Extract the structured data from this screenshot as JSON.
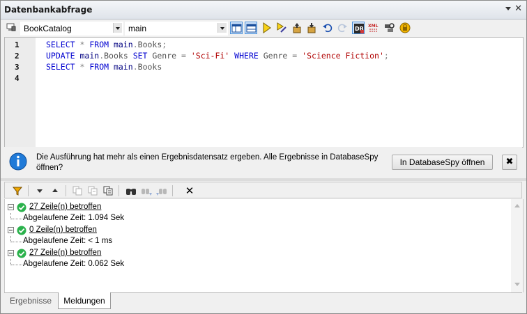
{
  "window": {
    "title": "Datenbankabfrage"
  },
  "toolbar": {
    "connection": "BookCatalog",
    "schema": "main",
    "icons": [
      "connection-icon",
      "layout-editor-icon",
      "layout-results-icon",
      "execute-icon",
      "execute-for-edit-icon",
      "import-file-icon",
      "export-file-icon",
      "undo-icon",
      "redo-icon",
      "open-in-databasespy-icon",
      "xml-schema-icon",
      "options-icon",
      "autocommit-icon"
    ]
  },
  "editor": {
    "line_numbers": [
      "1",
      "2",
      "3",
      "4"
    ],
    "lines": [
      [
        {
          "t": "SELECT",
          "c": "kw"
        },
        {
          "t": " ",
          "c": ""
        },
        {
          "t": "*",
          "c": "op"
        },
        {
          "t": " ",
          "c": ""
        },
        {
          "t": "FROM",
          "c": "kw"
        },
        {
          "t": " ",
          "c": ""
        },
        {
          "t": "main",
          "c": "id"
        },
        {
          "t": ".",
          "c": "op"
        },
        {
          "t": "Books",
          "c": "gy"
        },
        {
          "t": ";",
          "c": "op"
        }
      ],
      [
        {
          "t": "UPDATE",
          "c": "kw"
        },
        {
          "t": " ",
          "c": ""
        },
        {
          "t": "main",
          "c": "id"
        },
        {
          "t": ".",
          "c": "op"
        },
        {
          "t": "Books",
          "c": "gy"
        },
        {
          "t": " ",
          "c": ""
        },
        {
          "t": "SET",
          "c": "kw"
        },
        {
          "t": " ",
          "c": ""
        },
        {
          "t": "Genre",
          "c": "gy"
        },
        {
          "t": " ",
          "c": ""
        },
        {
          "t": "=",
          "c": "op"
        },
        {
          "t": " ",
          "c": ""
        },
        {
          "t": "'Sci-Fi'",
          "c": "str"
        },
        {
          "t": " ",
          "c": ""
        },
        {
          "t": "WHERE",
          "c": "kw"
        },
        {
          "t": " ",
          "c": ""
        },
        {
          "t": "Genre",
          "c": "gy"
        },
        {
          "t": " ",
          "c": ""
        },
        {
          "t": "=",
          "c": "op"
        },
        {
          "t": " ",
          "c": ""
        },
        {
          "t": "'Science Fiction'",
          "c": "str"
        },
        {
          "t": ";",
          "c": "op"
        }
      ],
      [
        {
          "t": "SELECT",
          "c": "kw"
        },
        {
          "t": " ",
          "c": ""
        },
        {
          "t": "*",
          "c": "op"
        },
        {
          "t": " ",
          "c": ""
        },
        {
          "t": "FROM",
          "c": "kw"
        },
        {
          "t": " ",
          "c": ""
        },
        {
          "t": "main",
          "c": "id"
        },
        {
          "t": ".",
          "c": "op"
        },
        {
          "t": "Books",
          "c": "gy"
        }
      ],
      []
    ]
  },
  "infobar": {
    "message": "Die Ausführung hat mehr als einen Ergebnisdatensatz ergeben. Alle Ergebnisse in DatabaseSpy öffnen?",
    "open_button": "In DatabaseSpy öffnen",
    "close_label": "✖"
  },
  "messages": [
    {
      "summary": "27 Zeile(n) betroffen",
      "detail": "Abgelaufene Zeit: 1.094 Sek"
    },
    {
      "summary": "0 Zeile(n) betroffen",
      "detail": "Abgelaufene Zeit: < 1 ms"
    },
    {
      "summary": "27 Zeile(n) betroffen",
      "detail": "Abgelaufene Zeit: 0.062 Sek"
    }
  ],
  "results_toolbar": {
    "close_label": "✕"
  },
  "tabs": [
    {
      "label": "Ergebnisse",
      "active": false
    },
    {
      "label": "Meldungen",
      "active": true
    }
  ],
  "colors": {
    "keyword": "#0000d0",
    "string": "#b00000",
    "success": "#2bb24c",
    "info": "#1f7ad8"
  }
}
